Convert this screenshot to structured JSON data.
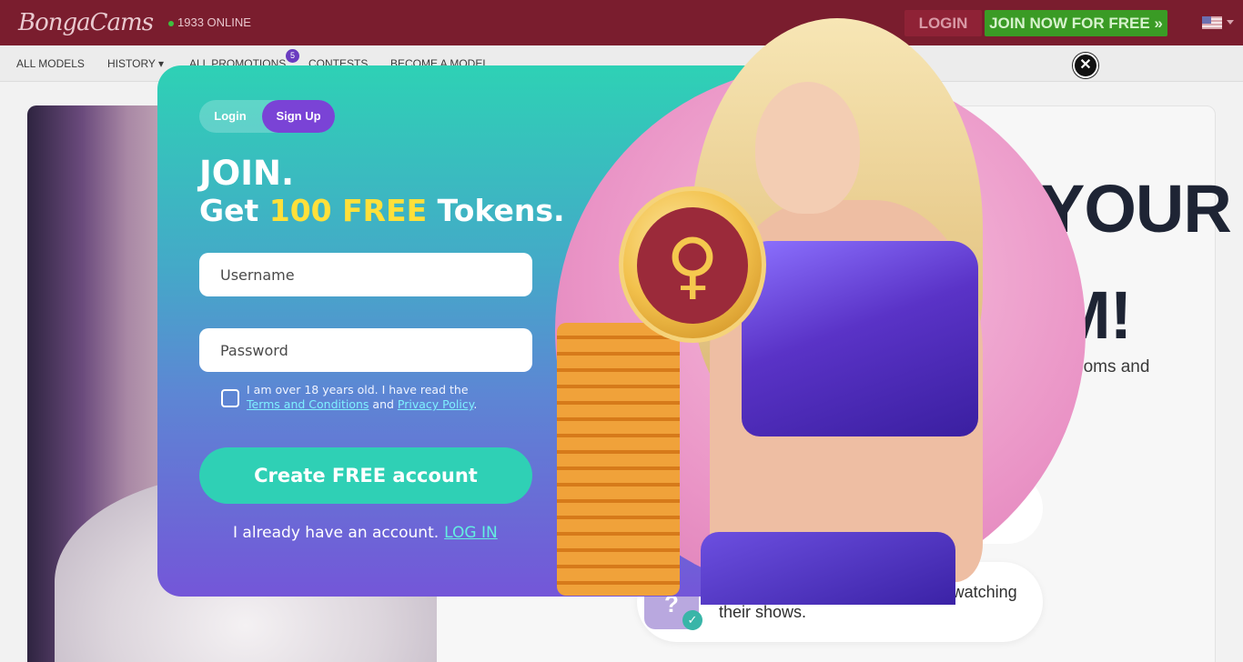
{
  "header": {
    "logo_text": "BongaCams",
    "online_count": "1933 ONLINE",
    "login_label": "LOGIN",
    "join_label": "JOIN NOW FOR FREE »"
  },
  "nav": {
    "items": [
      {
        "label": "ALL MODELS"
      },
      {
        "label": "HISTORY ▾"
      },
      {
        "label": "ALL PROMOTIONS"
      },
      {
        "label": "CONTESTS"
      },
      {
        "label": "BECOME A MODEL"
      }
    ],
    "promotions_badge": "5"
  },
  "background": {
    "headline_line1": "YOUR",
    "headline_line2": "M!",
    "text_fragment": "ooms and",
    "pill_text": "Models won't know that you are watching their shows.",
    "pill_icon_glyph": "?",
    "pill_check_glyph": "✓"
  },
  "modal": {
    "tab_login": "Login",
    "tab_signup": "Sign Up",
    "title_line1": "JOIN.",
    "title_get": "Get ",
    "title_highlight": "100 FREE",
    "title_tokens": " Tokens.",
    "username_placeholder": "Username",
    "password_placeholder": "Password",
    "terms_prefix": "I am over 18 years old. I have read the ",
    "terms_link": "Terms and Conditions",
    "terms_and": " and ",
    "privacy_link": "Privacy Policy",
    "terms_suffix": ".",
    "create_button": "Create FREE account",
    "already_text": "I already have an account.",
    "login_link": "LOG IN",
    "close_glyph": "✕",
    "coin_glyph": "♀"
  },
  "colors": {
    "header_bg": "#7a1d2e",
    "join_green": "#3a9b25",
    "modal_teal": "#2ed1b5",
    "modal_purple": "#7456d8",
    "highlight_yellow": "#ffe03a",
    "signup_purple": "#7a43d6"
  }
}
